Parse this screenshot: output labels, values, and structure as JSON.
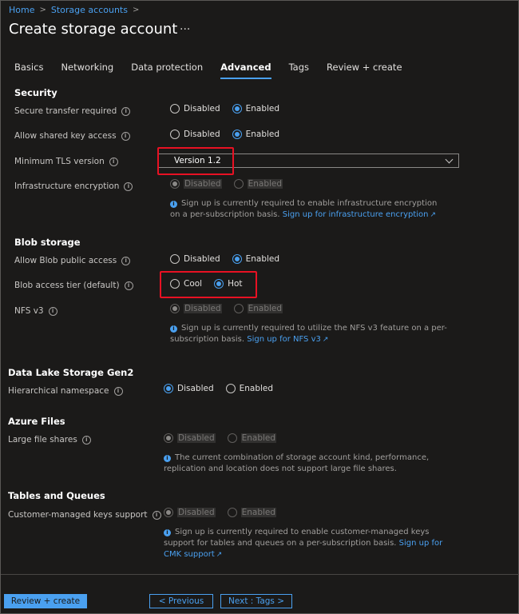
{
  "breadcrumb": {
    "home": "Home",
    "storage": "Storage accounts"
  },
  "page": {
    "title": "Create storage account",
    "more": "···"
  },
  "tabs": [
    "Basics",
    "Networking",
    "Data protection",
    "Advanced",
    "Tags",
    "Review + create"
  ],
  "security": {
    "heading": "Security",
    "secure_transfer": {
      "label": "Secure transfer required",
      "options": [
        "Disabled",
        "Enabled"
      ],
      "selected": "Enabled"
    },
    "shared_key": {
      "label": "Allow shared key access",
      "options": [
        "Disabled",
        "Enabled"
      ],
      "selected": "Enabled"
    },
    "tls": {
      "label": "Minimum TLS version",
      "value": "Version 1.2"
    },
    "infra": {
      "label": "Infrastructure encryption",
      "options": [
        "Disabled",
        "Enabled"
      ],
      "selected": "Disabled",
      "note": "Sign up is currently required to enable infrastructure encryption on a per-subscription basis.",
      "link": "Sign up for infrastructure encryption"
    }
  },
  "blob": {
    "heading": "Blob storage",
    "public_access": {
      "label": "Allow Blob public access",
      "options": [
        "Disabled",
        "Enabled"
      ],
      "selected": "Enabled"
    },
    "tier": {
      "label": "Blob access tier (default)",
      "options": [
        "Cool",
        "Hot"
      ],
      "selected": "Hot"
    },
    "nfs": {
      "label": "NFS v3",
      "options": [
        "Disabled",
        "Enabled"
      ],
      "selected": "Disabled",
      "note": "Sign up is currently required to utilize the NFS v3 feature on a per-subscription basis.",
      "link": "Sign up for NFS v3"
    }
  },
  "datalake": {
    "heading": "Data Lake Storage Gen2",
    "hns": {
      "label": "Hierarchical namespace",
      "options": [
        "Disabled",
        "Enabled"
      ],
      "selected": "Disabled"
    }
  },
  "files": {
    "heading": "Azure Files",
    "large": {
      "label": "Large file shares",
      "options": [
        "Disabled",
        "Enabled"
      ],
      "selected": "Disabled",
      "note": "The current combination of storage account kind, performance, replication and location does not support large file shares."
    }
  },
  "tables": {
    "heading": "Tables and Queues",
    "cmk": {
      "label": "Customer-managed keys support",
      "options": [
        "Disabled",
        "Enabled"
      ],
      "selected": "Disabled",
      "note": "Sign up is currently required to enable customer-managed keys support for tables and queues on a per-subscription basis.",
      "link": "Sign up for CMK support"
    }
  },
  "footer": {
    "review": "Review + create",
    "previous": "< Previous",
    "next": "Next : Tags >"
  },
  "colors": {
    "accent": "#4aa0f0",
    "highlight": "#e81123",
    "background": "#1b1a19"
  }
}
